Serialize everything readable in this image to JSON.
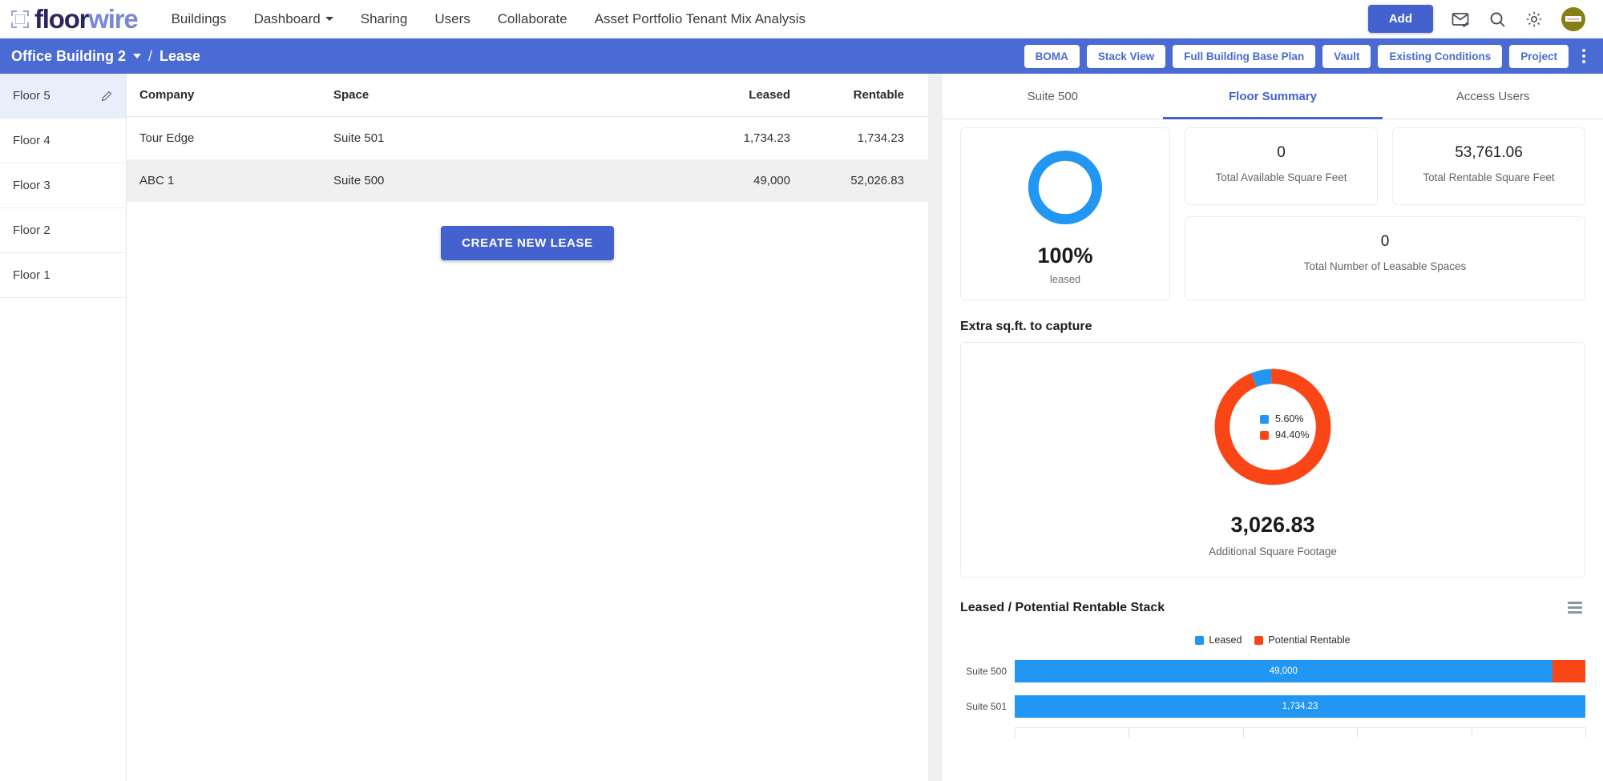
{
  "brand": {
    "name_a": "floor",
    "name_b": "wire"
  },
  "topnav": {
    "items": [
      {
        "label": "Buildings",
        "has_caret": false
      },
      {
        "label": "Dashboard",
        "has_caret": true
      },
      {
        "label": "Sharing",
        "has_caret": false
      },
      {
        "label": "Users",
        "has_caret": false
      },
      {
        "label": "Collaborate",
        "has_caret": false
      },
      {
        "label": "Asset Portfolio Tenant Mix Analysis",
        "has_caret": false
      }
    ],
    "add_label": "Add",
    "icons": [
      "mail-check-icon",
      "search-icon",
      "gear-icon",
      "avatar"
    ],
    "avatar_text": "floorwire"
  },
  "breadcrumb": {
    "building": "Office Building 2",
    "separator": "/",
    "section": "Lease",
    "buttons": [
      "BOMA",
      "Stack View",
      "Full Building Base Plan",
      "Vault",
      "Existing Conditions",
      "Project"
    ]
  },
  "floors": {
    "items": [
      {
        "label": "Floor 5",
        "active": true
      },
      {
        "label": "Floor 4",
        "active": false
      },
      {
        "label": "Floor 3",
        "active": false
      },
      {
        "label": "Floor 2",
        "active": false
      },
      {
        "label": "Floor 1",
        "active": false
      }
    ]
  },
  "lease_table": {
    "columns": [
      "Company",
      "Space",
      "Leased",
      "Rentable"
    ],
    "rows": [
      {
        "company": "Tour Edge",
        "space": "Suite 501",
        "leased": "1,734.23",
        "rentable": "1,734.23"
      },
      {
        "company": "ABC 1",
        "space": "Suite 500",
        "leased": "49,000",
        "rentable": "52,026.83"
      }
    ],
    "create_button": "CREATE NEW LEASE"
  },
  "right_panel": {
    "tabs": [
      {
        "label": "Suite 500",
        "active": false
      },
      {
        "label": "Floor Summary",
        "active": true
      },
      {
        "label": "Access Users",
        "active": false
      }
    ],
    "leased_gauge": {
      "percent": "100%",
      "caption": "leased",
      "value": 100,
      "color": "#2196f3"
    },
    "kpis": [
      {
        "value": "0",
        "label": "Total Available Square Feet"
      },
      {
        "value": "53,761.06",
        "label": "Total Rentable Square Feet"
      },
      {
        "value": "0",
        "label": "Total Number of Leasable Spaces"
      }
    ],
    "extra_section": {
      "title": "Extra sq.ft. to capture",
      "value": "3,026.83",
      "label": "Additional Square Footage"
    },
    "stack_section": {
      "title": "Leased / Potential Rentable Stack",
      "menu_icon": "hamburger-icon"
    }
  },
  "chart_data": [
    {
      "type": "pie",
      "title": "Leased percentage gauge",
      "labels": [
        "leased"
      ],
      "values": [
        100
      ],
      "colors": [
        "#2196f3"
      ],
      "center_label": "100%",
      "center_sublabel": "leased",
      "donut": true
    },
    {
      "type": "pie",
      "title": "Extra sq.ft. to capture",
      "labels": [
        "5.60%",
        "94.40%"
      ],
      "values": [
        5.6,
        94.4
      ],
      "colors": [
        "#2196f3",
        "#fa4616"
      ],
      "legend_position": "center",
      "center_label": "3,026.83",
      "center_sublabel": "Additional Square Footage",
      "donut": true
    },
    {
      "type": "bar",
      "orientation": "horizontal",
      "stacked": true,
      "title": "Leased / Potential Rentable Stack",
      "categories": [
        "Suite 500",
        "Suite 501"
      ],
      "series": [
        {
          "name": "Leased",
          "color": "#2196f3",
          "values": [
            49000,
            1734.23
          ],
          "labels": [
            "49,000",
            "1,734.23"
          ]
        },
        {
          "name": "Potential Rentable",
          "color": "#fa4616",
          "values": [
            3026.83,
            0
          ],
          "labels": [
            "",
            ""
          ]
        }
      ],
      "legend_position": "top",
      "grid": true,
      "xlim": [
        0,
        52026.83
      ]
    }
  ]
}
